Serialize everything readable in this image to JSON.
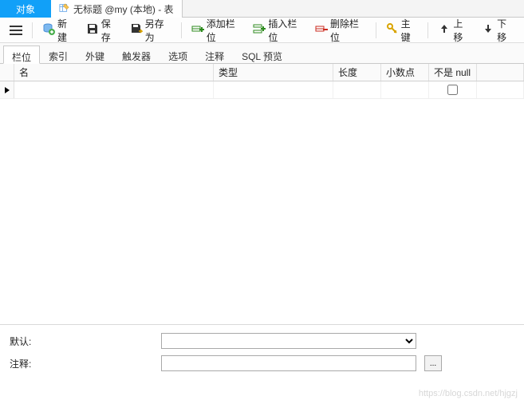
{
  "tabs": {
    "object": "对象",
    "doc_title": "无标题 @my (本地) - 表"
  },
  "toolbar": {
    "new": "新建",
    "save": "保存",
    "save_as": "另存为",
    "add_field": "添加栏位",
    "insert_field": "插入栏位",
    "delete_field": "删除栏位",
    "primary_key": "主键",
    "move_up": "上移",
    "move_down": "下移"
  },
  "subtabs": [
    "栏位",
    "索引",
    "外键",
    "触发器",
    "选项",
    "注释",
    "SQL 预览"
  ],
  "grid": {
    "columns": {
      "name": "名",
      "type": "类型",
      "length": "长度",
      "decimals": "小数点",
      "not_null": "不是 null"
    },
    "rows": [
      {
        "name": "",
        "type": "",
        "length": "",
        "decimals": "",
        "not_null": false
      }
    ]
  },
  "bottom": {
    "default_label": "默认:",
    "default_value": "",
    "comment_label": "注释:",
    "comment_value": "",
    "more_button": "..."
  },
  "watermark": "https://blog.csdn.net/hjgzj",
  "colors": {
    "primary_blue": "#11a0f8",
    "green": "#2e8b1f",
    "red": "#cc2a1f",
    "gold": "#d9a400"
  }
}
